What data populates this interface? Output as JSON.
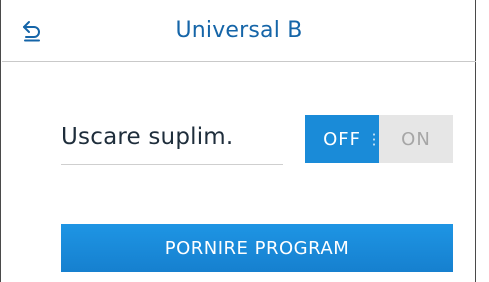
{
  "header": {
    "title": "Universal B",
    "back_icon": "back-arrow-icon"
  },
  "option": {
    "label": "Uscare suplim.",
    "toggle": {
      "off_label": "OFF",
      "on_label": "ON",
      "selected": "OFF"
    }
  },
  "actions": {
    "start_label": "PORNIRE PROGRAM"
  },
  "colors": {
    "accent": "#1a8bd8",
    "title": "#1565a8",
    "text": "#1e2d3b",
    "toggle_inactive_bg": "#e6e6e6",
    "toggle_inactive_text": "#a6a6a6"
  }
}
